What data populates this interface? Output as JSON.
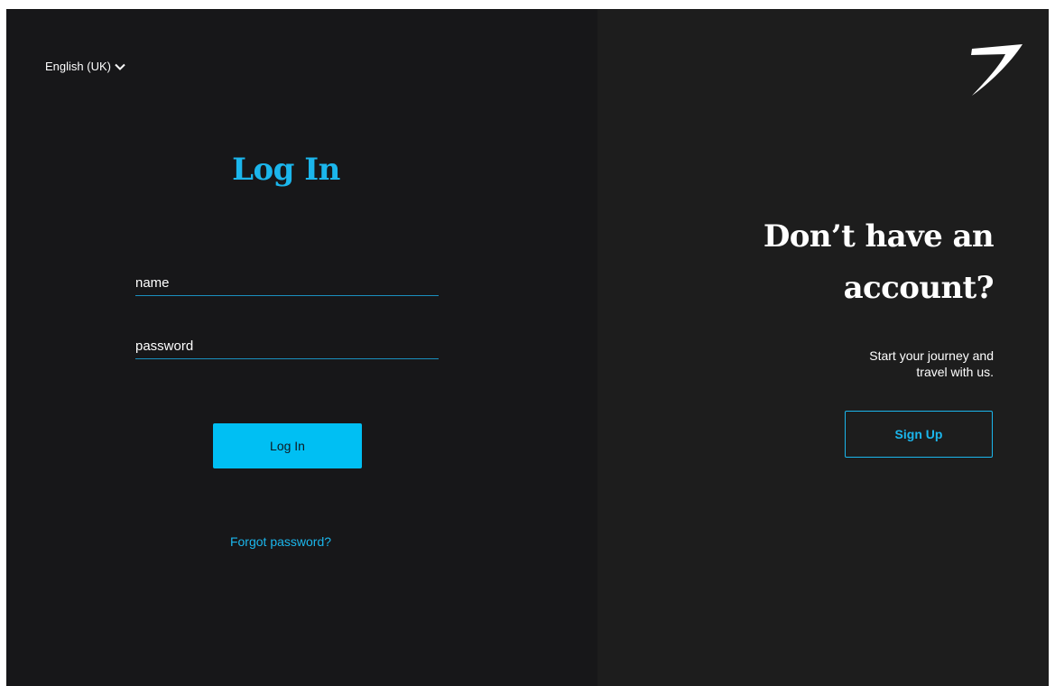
{
  "language_selector": {
    "label": "English (UK)",
    "icon": "chevron-down-icon"
  },
  "login": {
    "title": "Log In",
    "name_placeholder": "name",
    "password_placeholder": "password",
    "button_label": "Log In",
    "forgot_label": "Forgot password?"
  },
  "signup": {
    "logo_icon": "swoosh-logo-icon",
    "title_line1": "Don’t have an",
    "title_line2": "account?",
    "subtitle_line1": "Start your journey and",
    "subtitle_line2": "travel with us.",
    "button_label": "Sign Up"
  },
  "colors": {
    "accent": "#00bff3",
    "link": "#1bb6ec",
    "left_panel_bg": "#171719",
    "right_panel_bg": "#1d1d1d"
  }
}
